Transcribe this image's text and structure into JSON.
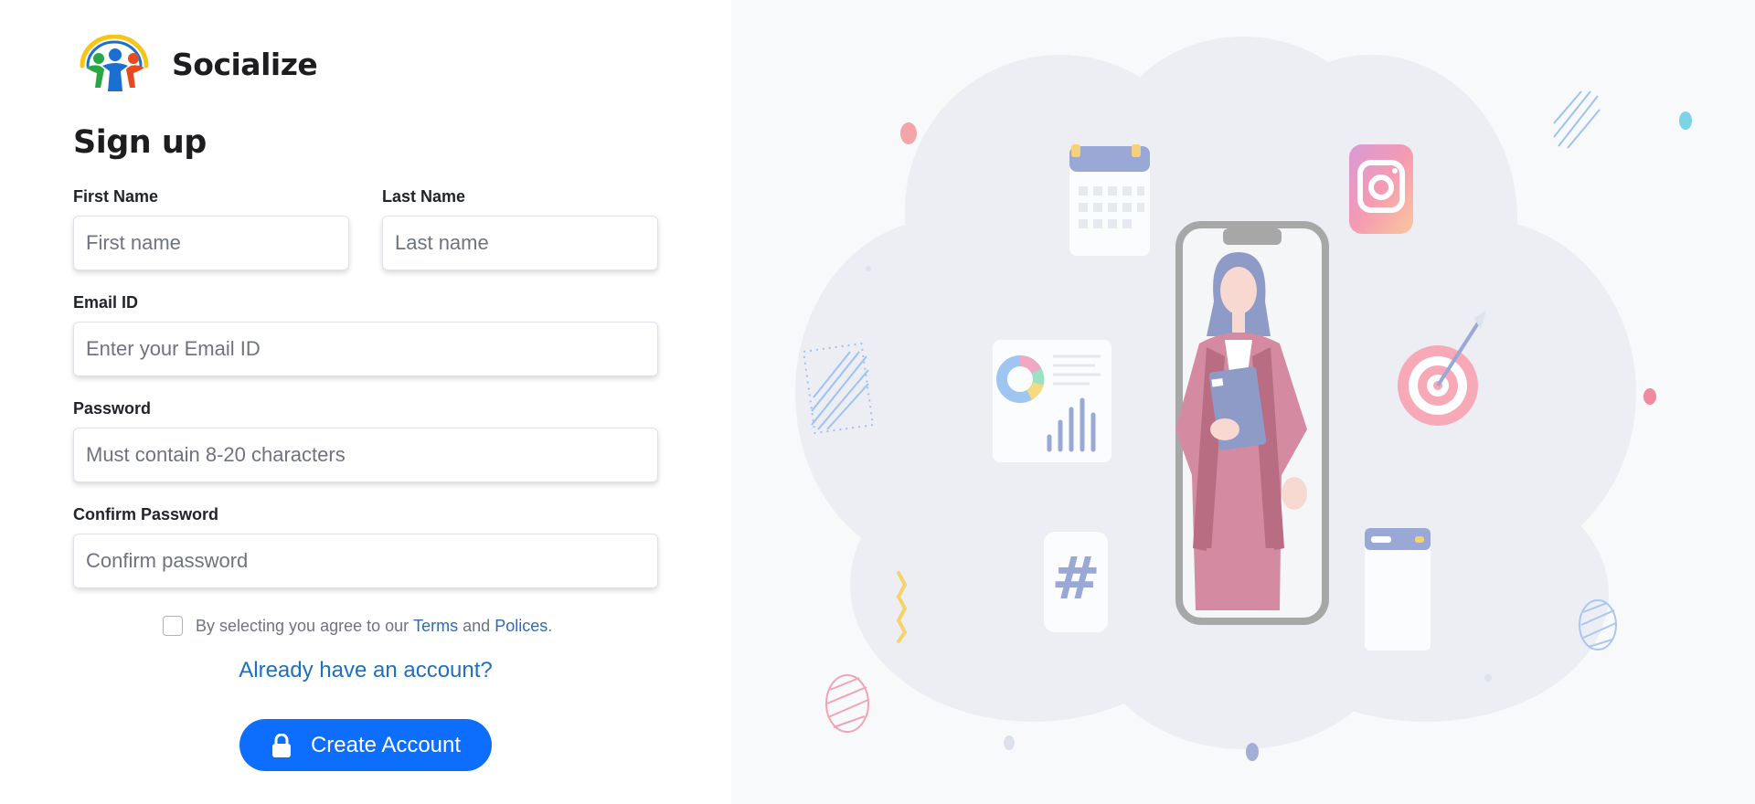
{
  "brand": {
    "name": "Socialize"
  },
  "form": {
    "heading": "Sign up",
    "first_name": {
      "label": "First Name",
      "placeholder": "First name"
    },
    "last_name": {
      "label": "Last Name",
      "placeholder": "Last name"
    },
    "email": {
      "label": "Email ID",
      "placeholder": "Enter your Email ID"
    },
    "password": {
      "label": "Password",
      "placeholder": "Must contain 8-20 characters"
    },
    "confirm_password": {
      "label": "Confirm Password",
      "placeholder": "Confirm password"
    },
    "agree": {
      "prefix": "By selecting you agree to our",
      "terms": "Terms",
      "and": "and",
      "policies": "Polices",
      "suffix": "."
    },
    "signin_link": "Already have an account?",
    "submit_label": "Create Account"
  },
  "illustration": {
    "icons": [
      "calendar-icon",
      "instagram-icon",
      "pie-chart-icon",
      "bar-chart-icon",
      "target-icon",
      "hashtag-icon",
      "browser-window-icon",
      "smartphone-icon",
      "woman-figure"
    ]
  },
  "colors": {
    "primary": "#0d6efd",
    "link": "#2b6cb8",
    "panel_bg": "#f8f9fa"
  }
}
